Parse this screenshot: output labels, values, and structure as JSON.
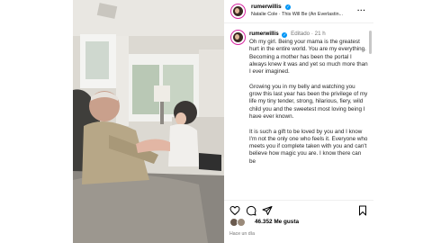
{
  "header": {
    "username": "rumerwillis",
    "song": "Natalie Cole · This Will Be (An Everlastin..."
  },
  "caption": {
    "username": "rumerwillis",
    "edited": "Editado",
    "age": "21 h",
    "paragraphs": [
      "Oh my girl. Being your mama is the greatest hurt in the entire world. You are my everything. Becoming a mother has been the portal I always knew it was and yet so much more than I ever imagined.",
      "Growing you in my belly and watching you grow this last year has been the privilege of my life my tiny tender, strong, hilarious, fiery, wild child you and the sweetest most loving being I have ever known.",
      "It is such a gift to be loved by you and I know I'm not the only one who feels it. Everyone who meets you if complete taken with you and can't believe how magic you are. I know there can be"
    ]
  },
  "likes": {
    "count_text": "46.352 Me gusta"
  },
  "timestamp": "Hace un día",
  "icons": {
    "more": "more-options-icon",
    "like": "heart-icon",
    "comment": "comment-icon",
    "share": "share-icon",
    "save": "bookmark-icon"
  },
  "colors": {
    "verified": "#0095f6",
    "story_ring": "#d6249f",
    "meta_text": "#737373"
  }
}
